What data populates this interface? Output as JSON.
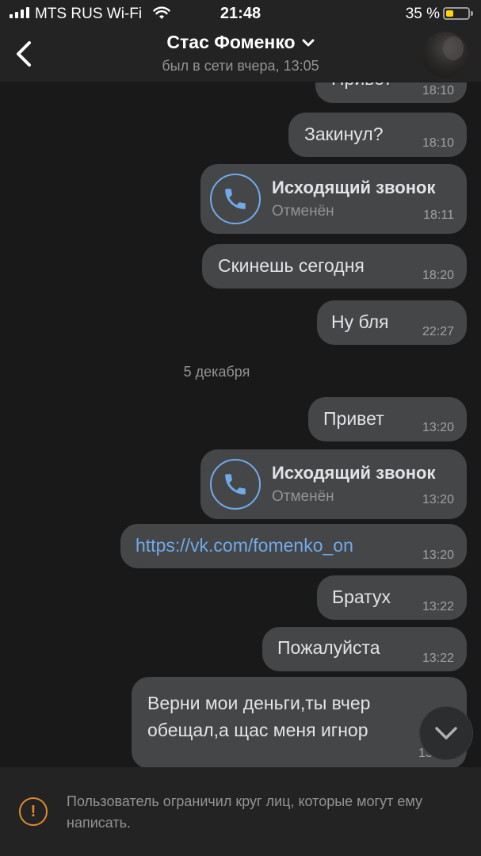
{
  "status_bar": {
    "carrier": "MTS RUS Wi-Fi",
    "time": "21:48",
    "battery_percent": "35 %",
    "battery_level": 0.35,
    "battery_color": "#ffd60a"
  },
  "header": {
    "back_icon": "chevron-left-icon",
    "contact_name": "Стас Фоменко",
    "dropdown_icon": "chevron-down-icon",
    "last_seen": "был в сети вчера, 13:05"
  },
  "messages": [
    {
      "type": "text",
      "text": "Привет",
      "time": "18:10"
    },
    {
      "type": "text",
      "text": "Закинул?",
      "time": "18:10"
    },
    {
      "type": "call",
      "title": "Исходящий звонок",
      "status": "Отменён",
      "time": "18:11"
    },
    {
      "type": "text",
      "text": "Скинешь сегодня",
      "time": "18:20"
    },
    {
      "type": "text",
      "text": "Ну бля",
      "time": "22:27"
    },
    {
      "type": "date",
      "text": "5 декабря"
    },
    {
      "type": "text",
      "text": "Привет",
      "time": "13:20"
    },
    {
      "type": "call",
      "title": "Исходящий звонок",
      "status": "Отменён",
      "time": "13:20"
    },
    {
      "type": "link",
      "text": "https://vk.com/fomenko_on",
      "time": "13:20"
    },
    {
      "type": "text",
      "text": "Братух",
      "time": "13:22"
    },
    {
      "type": "text",
      "text": "Пожалуйста",
      "time": "13:22"
    },
    {
      "type": "text",
      "line1": "Верни мои деньги,ты вчер",
      "line2": "обещал,а щас меня игнор",
      "time": "13"
    }
  ],
  "scroll_down_icon": "chevron-down-icon",
  "footer": {
    "warning_icon": "exclamation-circle-icon",
    "text": "Пользователь ограничил круг лиц, которые могут ему написать."
  },
  "colors": {
    "background": "#19191a",
    "bubble": "#454647",
    "accent": "#71aaeb",
    "warning": "#e08b2e"
  }
}
